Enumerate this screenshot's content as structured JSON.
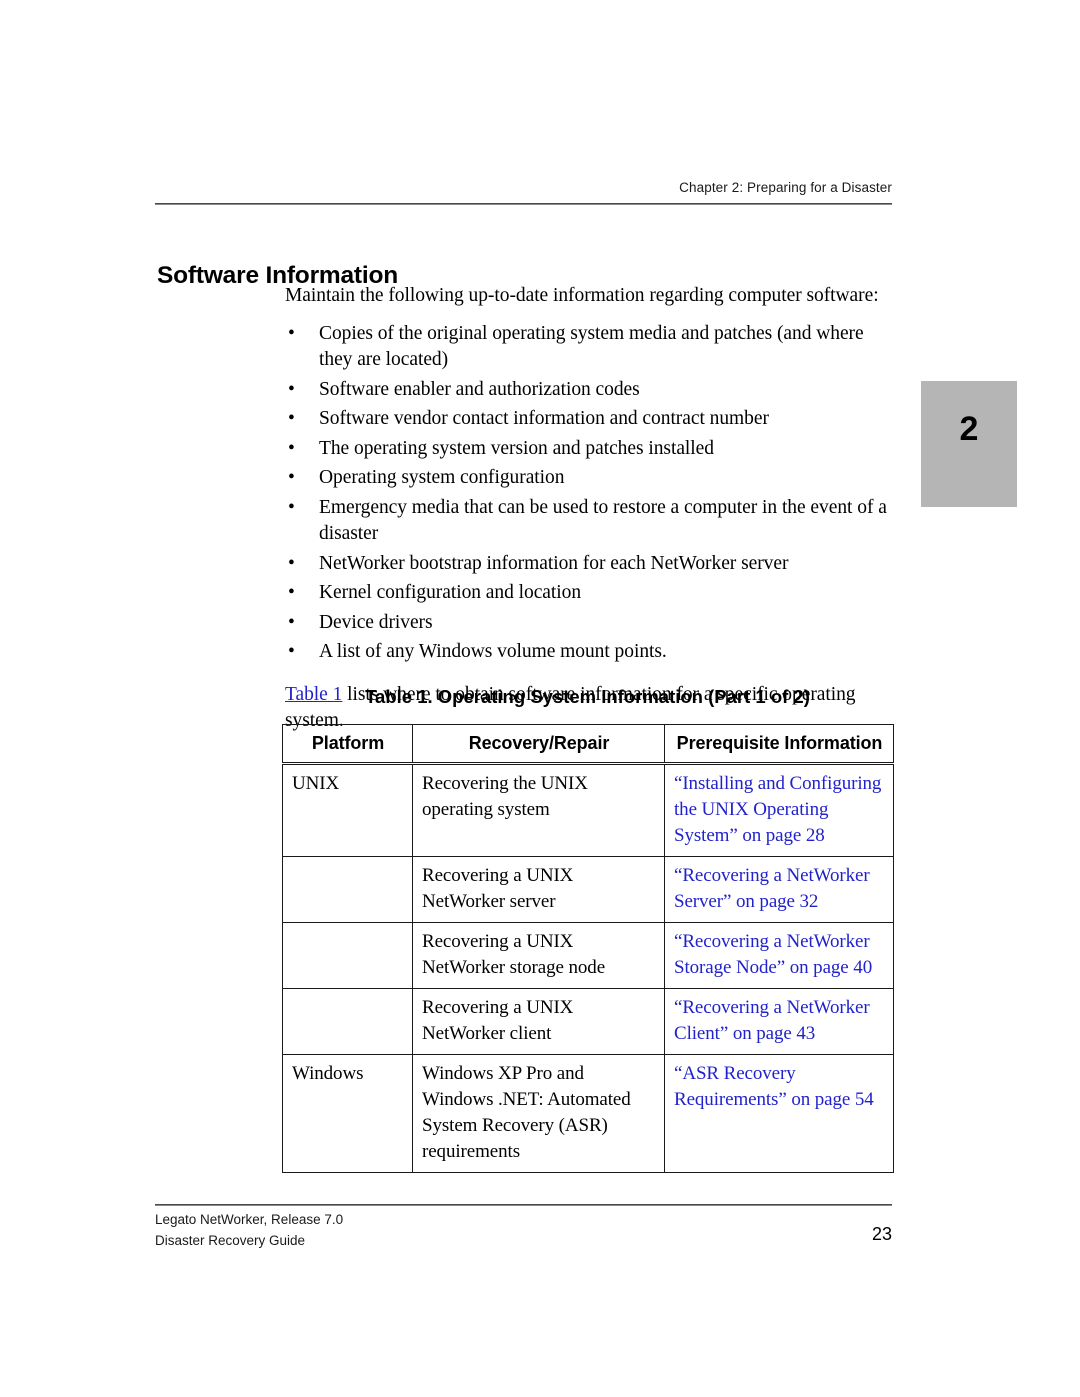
{
  "header": {
    "running_head": "Chapter 2: Preparing for a Disaster"
  },
  "chapter_tab": {
    "number": "2"
  },
  "section": {
    "heading": "Software Information",
    "intro": "Maintain the following up-to-date information regarding computer software:",
    "bullets": [
      "Copies of the original operating system media and patches (and where they are located)",
      "Software enabler and authorization codes",
      "Software vendor contact information and contract number",
      "The operating system version and patches installed",
      "Operating system configuration",
      "Emergency media that can be used to restore a computer in the event of a disaster",
      "NetWorker bootstrap information for each NetWorker server",
      "Kernel configuration and location",
      "Device drivers",
      "A list of any Windows volume mount points."
    ],
    "bullet_marker": "•",
    "table_ref_link": "Table 1",
    "table_ref_rest": " lists where to obtain software information for a specific operating system."
  },
  "table": {
    "caption": "Table 1. Operating System Information  (Part 1 of 2)",
    "columns": [
      "Platform",
      "Recovery/Repair",
      "Prerequisite Information"
    ],
    "rows": [
      {
        "platform": "UNIX",
        "recovery": "Recovering the UNIX operating system",
        "prerequisite": "“Installing and Configuring the UNIX Operating System” on page 28"
      },
      {
        "platform": "",
        "recovery": "Recovering a UNIX NetWorker server",
        "prerequisite": "“Recovering a NetWorker Server” on page 32"
      },
      {
        "platform": "",
        "recovery": "Recovering a UNIX NetWorker storage node",
        "prerequisite": "“Recovering a NetWorker Storage Node” on page 40"
      },
      {
        "platform": "",
        "recovery": "Recovering a UNIX NetWorker client",
        "prerequisite": "“Recovering a NetWorker Client” on page 43"
      },
      {
        "platform": "Windows",
        "recovery": "Windows XP Pro and Windows .NET: Automated System Recovery (ASR) requirements",
        "prerequisite": "“ASR Recovery Requirements” on page 54"
      }
    ]
  },
  "footer": {
    "line1": "Legato NetWorker, Release 7.0",
    "line2": "Disaster Recovery Guide",
    "page_number": "23"
  },
  "colors": {
    "link": "#2222cc",
    "tab_background": "#b5b5b5",
    "rule": "#8a8a8a"
  }
}
